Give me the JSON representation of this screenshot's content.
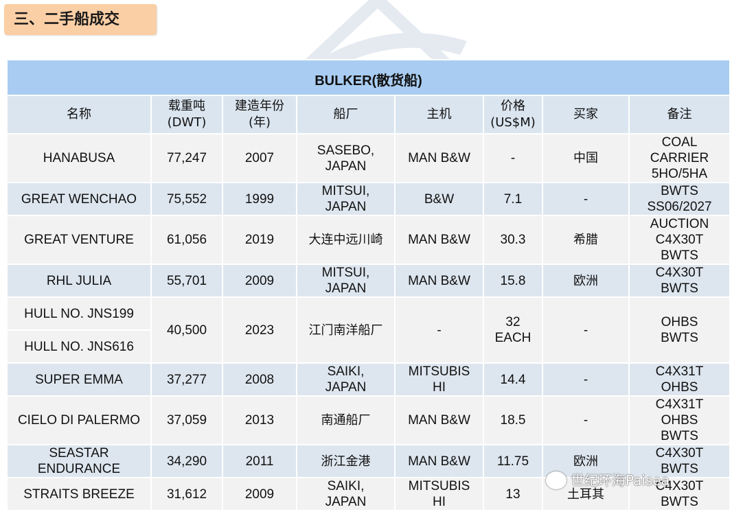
{
  "section_title": "三、二手船成交",
  "watermark_text": "paisea",
  "table": {
    "title": "BULKER(散货船)",
    "headers": [
      {
        "line1": "名称",
        "line2": ""
      },
      {
        "line1": "载重吨",
        "line2": "(DWT)"
      },
      {
        "line1": "建造年份",
        "line2": "(年)"
      },
      {
        "line1": "船厂",
        "line2": ""
      },
      {
        "line1": "主机",
        "line2": ""
      },
      {
        "line1": "价格",
        "line2": "(US$M)"
      },
      {
        "line1": "买家",
        "line2": ""
      },
      {
        "line1": "备注",
        "line2": ""
      }
    ],
    "rows": [
      {
        "name": "HANABUSA",
        "dwt": "77,247",
        "year": "2007",
        "yard": [
          "SASEBO,",
          "JAPAN"
        ],
        "engine": [
          "MAN B&W"
        ],
        "price": [
          "-"
        ],
        "buyer": "中国",
        "remarks": [
          "COAL",
          "CARRIER",
          "5HO/5HA"
        ]
      },
      {
        "name": "GREAT WENCHAO",
        "dwt": "75,552",
        "year": "1999",
        "yard": [
          "MITSUI,",
          "JAPAN"
        ],
        "engine": [
          "B&W"
        ],
        "price": [
          "7.1"
        ],
        "buyer": "-",
        "remarks": [
          "BWTS",
          "SS06/2027"
        ]
      },
      {
        "name": "GREAT VENTURE",
        "dwt": "61,056",
        "year": "2019",
        "yard": [
          "大连中远川崎"
        ],
        "engine": [
          "MAN B&W"
        ],
        "price": [
          "30.3"
        ],
        "buyer": "希腊",
        "remarks": [
          "AUCTION",
          "C4X30T",
          "BWTS"
        ]
      },
      {
        "name": "RHL JULIA",
        "dwt": "55,701",
        "year": "2009",
        "yard": [
          "MITSUI,",
          "JAPAN"
        ],
        "engine": [
          "MAN B&W"
        ],
        "price": [
          "15.8"
        ],
        "buyer": "欧洲",
        "remarks": [
          "C4X30T",
          "BWTS"
        ]
      },
      {
        "name": "HULL NO. JNS199",
        "name2": "HULL NO. JNS616",
        "dwt": "40,500",
        "year": "2023",
        "yard": [
          "江门南洋船厂"
        ],
        "engine": [
          "-"
        ],
        "price": [
          "32",
          "EACH"
        ],
        "buyer": "-",
        "remarks": [
          "OHBS",
          "BWTS"
        ]
      },
      {
        "name": "SUPER EMMA",
        "dwt": "37,277",
        "year": "2008",
        "yard": [
          "SAIKI,",
          "JAPAN"
        ],
        "engine": [
          "MITSUBIS",
          "HI"
        ],
        "price": [
          "14.4"
        ],
        "buyer": "-",
        "remarks": [
          "C4X31T",
          "OHBS"
        ]
      },
      {
        "name": "CIELO DI PALERMO",
        "dwt": "37,059",
        "year": "2013",
        "yard": [
          "南通船厂"
        ],
        "engine": [
          "MAN B&W"
        ],
        "price": [
          "18.5"
        ],
        "buyer": "-",
        "remarks": [
          "C4X31T",
          "OHBS",
          "BWTS"
        ]
      },
      {
        "name": "SEASTAR ENDURANCE",
        "dwt": "34,290",
        "year": "2011",
        "yard": [
          "浙江金港"
        ],
        "engine": [
          "MAN B&W"
        ],
        "price": [
          "11.75"
        ],
        "buyer": "欧洲",
        "remarks": [
          "C4X30T",
          "BWTS"
        ]
      },
      {
        "name": "STRAITS BREEZE",
        "dwt": "31,612",
        "year": "2009",
        "yard": [
          "SAIKI,",
          "JAPAN"
        ],
        "engine": [
          "MITSUBIS",
          "HI"
        ],
        "price": [
          "13"
        ],
        "buyer": "土耳其",
        "remarks": [
          "C4X30T",
          "BWTS"
        ]
      }
    ]
  },
  "wechat_label": "世纪环海Paisea"
}
